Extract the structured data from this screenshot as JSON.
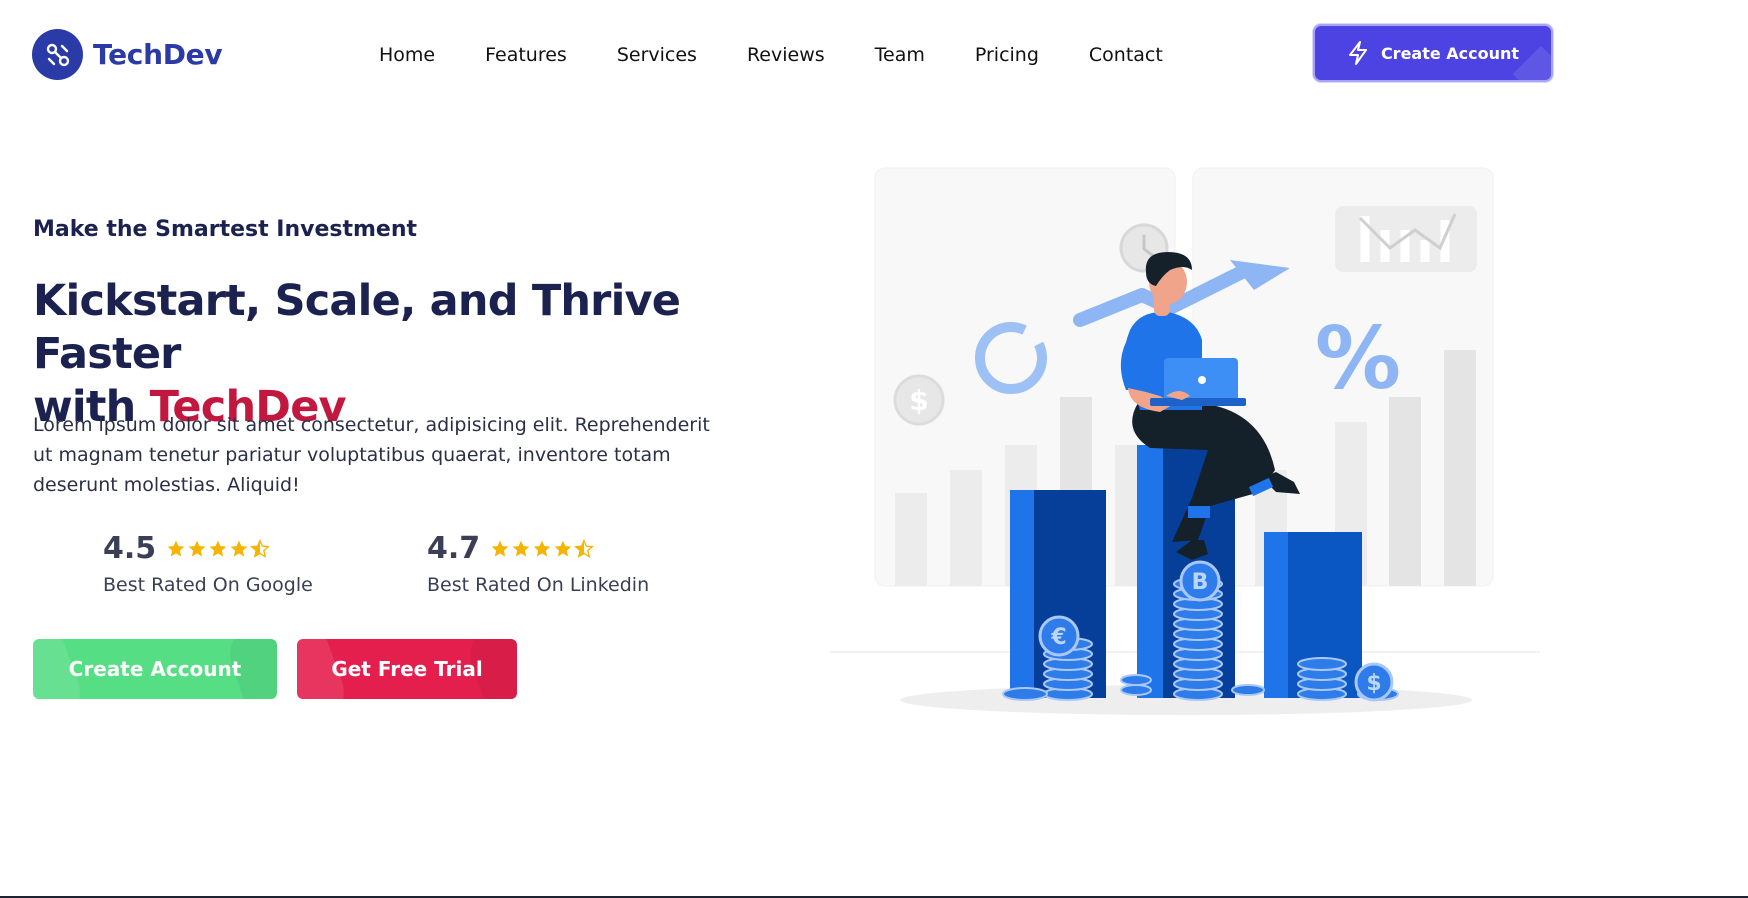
{
  "brand": {
    "name": "TechDev",
    "icon": "link-nodes-icon"
  },
  "nav": {
    "items": [
      {
        "label": "Home"
      },
      {
        "label": "Features"
      },
      {
        "label": "Services"
      },
      {
        "label": "Reviews"
      },
      {
        "label": "Team"
      },
      {
        "label": "Pricing"
      },
      {
        "label": "Contact"
      }
    ]
  },
  "header": {
    "cta_label": "Create Account",
    "cta_icon": "lightning-icon"
  },
  "hero": {
    "eyebrow": "Make the Smartest Investment",
    "headline_line1": "Kickstart, Scale, and Thrive Faster",
    "headline_with": "with",
    "headline_brand": "TechDev",
    "description": "Lorem ipsum dolor sit amet consectetur, adipisicing elit. Reprehenderit ut magnam tenetur pariatur voluptatibus quaerat, inventore totam deserunt molestias. Aliquid!",
    "ratings": [
      {
        "score": "4.5",
        "source": "Best Rated On Google",
        "stars": 4.5
      },
      {
        "score": "4.7",
        "source": "Best Rated On Linkedin",
        "stars": 4.5
      }
    ],
    "primary_cta": "Create Account",
    "secondary_cta": "Get Free Trial"
  },
  "colors": {
    "brand_blue": "#2b3aa5",
    "accent_red": "#c2183f",
    "header_button": "#4c43e2",
    "green_button": "#56de85",
    "red_button": "#e51f4d",
    "star": "#f5b400"
  }
}
